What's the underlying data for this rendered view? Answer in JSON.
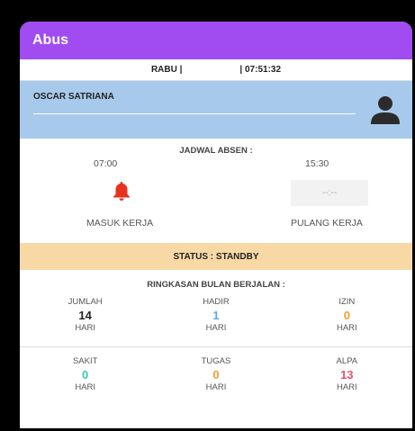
{
  "app": {
    "title": "Abus"
  },
  "datebar": {
    "day": "RABU |",
    "time": "| 07:51:32"
  },
  "user": {
    "name": "OSCAR SATRIANA"
  },
  "schedule": {
    "title": "JADWAL ABSEN :",
    "time_in": "07:00",
    "time_out": "15:30",
    "out_placeholder": "--:--",
    "label_in": "MASUK KERJA",
    "label_out": "PULANG KERJA"
  },
  "status": {
    "text": "STATUS : STANDBY"
  },
  "summary": {
    "title": "RINGKASAN BULAN BERJALAN :",
    "row1": [
      {
        "label": "JUMLAH",
        "value": "14",
        "unit": "HARI",
        "color": "#222222"
      },
      {
        "label": "HADIR",
        "value": "1",
        "unit": "HARI",
        "color": "#5aa9e6"
      },
      {
        "label": "IZIN",
        "value": "0",
        "unit": "HARI",
        "color": "#f0a030"
      }
    ],
    "row2": [
      {
        "label": "SAKIT",
        "value": "0",
        "unit": "HARI",
        "color": "#3cc8b4"
      },
      {
        "label": "TUGAS",
        "value": "0",
        "unit": "HARI",
        "color": "#f0a030"
      },
      {
        "label": "ALPA",
        "value": "13",
        "unit": "HARI",
        "color": "#e8506a"
      }
    ]
  },
  "colors": {
    "appbar": "#a04cf0",
    "userbar": "#a7c9ec",
    "status": "#f8d9a6",
    "bell": "#e8321e"
  }
}
